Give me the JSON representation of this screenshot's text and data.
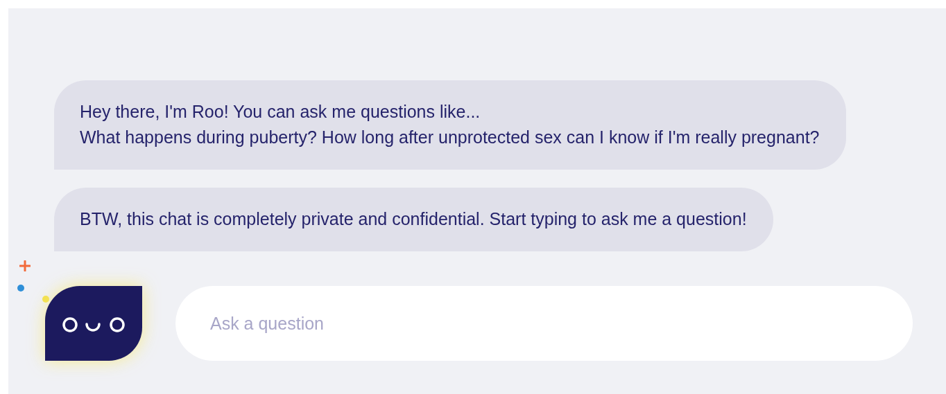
{
  "messages": [
    {
      "lines": [
        "Hey there, I'm Roo! You can ask me questions like...",
        "What happens during puberty? How long after unprotected sex can I know if I'm really pregnant?"
      ]
    },
    {
      "lines": [
        "BTW, this chat is completely private and confidential. Start typing to ask me a question!"
      ]
    }
  ],
  "composer": {
    "placeholder": "Ask a question"
  }
}
